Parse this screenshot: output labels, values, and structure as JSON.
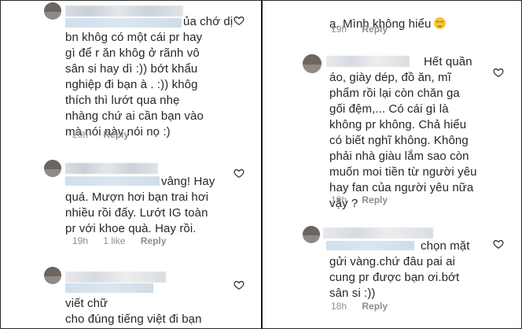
{
  "left": [
    {
      "text": "ủa chớ dị\nbn khôg có một cái pr hay\ngì để r ăn khôg ở rãnh vô\nsân si hay dì :)) bớt khẩu\nnghiệp đi bạn à . :)) khôg\nthích thì lướt qua nhẹ\nnhàng chứ ai cần bạn vào\nmà nói này nói nọ :)",
      "time": "20h",
      "likes": "",
      "reply": "Reply"
    },
    {
      "text": "vâng! Hay\nquá. Mượn hơi bạn trai hơi\nnhiều rồi đấy. Lướt IG toàn\npr với khoe quà. Hay rồi.",
      "time": "19h",
      "likes": "1 like",
      "reply": "Reply"
    },
    {
      "text": "viết chữ\ncho đúng tiếng việt đi bạn\nạ. Mình không hiểu",
      "time": "",
      "likes": "",
      "reply": ""
    }
  ],
  "right": [
    {
      "text": "ạ. Mình không hiểu",
      "time": "19h",
      "likes": "",
      "reply": "Reply"
    },
    {
      "text": "Hết quần\náo, giày dép, đồ ăn, mĩ\nphẩm rồi lại còn chăn ga\ngối đệm,... Có cái gì là\nkhông pr không. Chả hiểu\ncó biết nghĩ không. Không\nphải nhà giàu lắm sao còn\nmuốn moi tiền từ người yêu\nhay fan của người yêu nữa\nvậy ?",
      "time": "19h",
      "likes": "",
      "reply": "Reply"
    },
    {
      "text": "chọn mặt\ngửi vàng.chứ đâu pai ai\ncung pr được bạn ơi.bớt\nsân si :))",
      "time": "18h",
      "likes": "",
      "reply": "Reply"
    }
  ],
  "icons": {
    "heart": "heart-outline-icon",
    "emoji": "pensive-face-emoji"
  },
  "colors": {
    "text": "#262626",
    "meta": "#8e8e8e",
    "divider": "#1e1e1e"
  }
}
